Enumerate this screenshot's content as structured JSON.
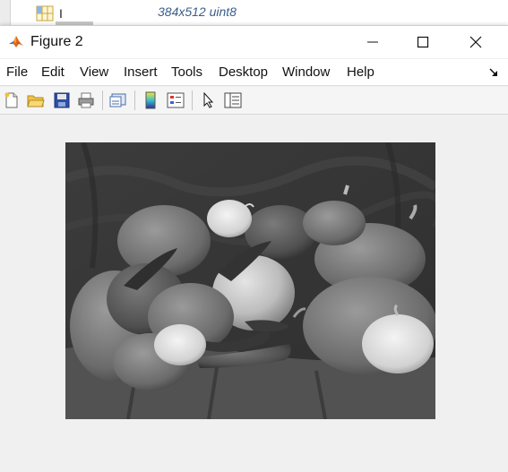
{
  "workspace": {
    "variable_name": "I",
    "variable_value": "384x512 uint8"
  },
  "window": {
    "title": "Figure 2"
  },
  "menu": {
    "items": [
      "File",
      "Edit",
      "View",
      "Insert",
      "Tools",
      "Desktop",
      "Window",
      "Help"
    ]
  },
  "toolbar": {
    "buttons": [
      "new-figure",
      "open-file",
      "save-figure",
      "print-figure",
      "link-plot",
      "insert-colorbar",
      "insert-legend",
      "edit-plot",
      "open-property-inspector"
    ]
  },
  "image": {
    "colormap": "grayscale",
    "content": "peppers"
  }
}
